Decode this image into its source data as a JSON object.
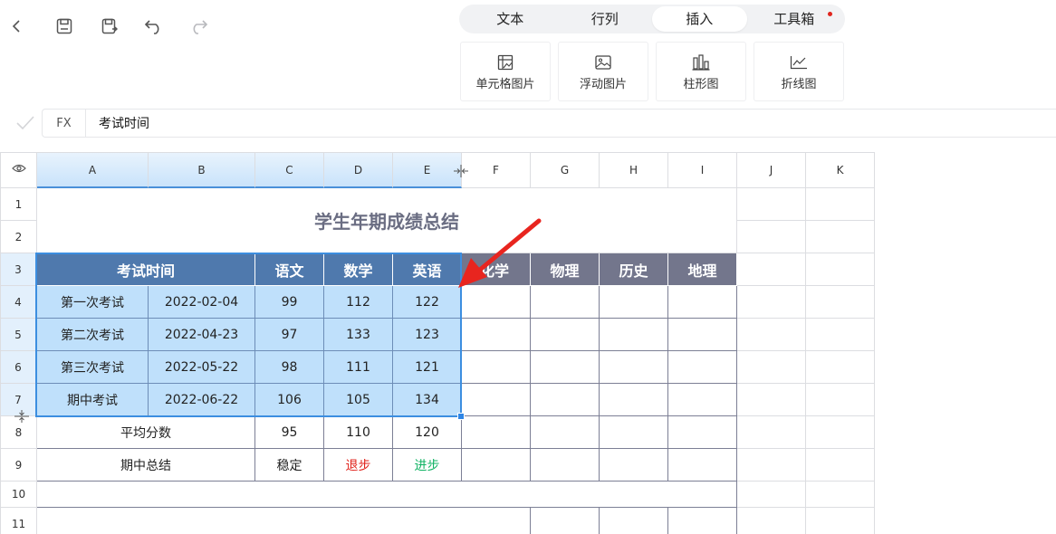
{
  "toolbar": {
    "tabs": [
      {
        "label": "文本",
        "active": false
      },
      {
        "label": "行列",
        "active": false
      },
      {
        "label": "插入",
        "active": true
      },
      {
        "label": "工具箱",
        "active": false,
        "notification": true
      }
    ],
    "insert_items": [
      {
        "label": "单元格图片",
        "icon": "cell-image-icon"
      },
      {
        "label": "浮动图片",
        "icon": "image-icon"
      },
      {
        "label": "柱形图",
        "icon": "bar-chart-icon"
      },
      {
        "label": "折线图",
        "icon": "line-chart-icon"
      }
    ]
  },
  "formula_bar": {
    "fx_label": "FX",
    "value": "考试时间"
  },
  "grid": {
    "columns": [
      "A",
      "B",
      "C",
      "D",
      "E",
      "F",
      "G",
      "H",
      "I",
      "J",
      "K"
    ],
    "rows": [
      "1",
      "2",
      "3",
      "4",
      "5",
      "6",
      "7",
      "8",
      "9",
      "10",
      "11"
    ],
    "title": "学生年期成绩总结",
    "header": {
      "exam_time": "考试时间",
      "chinese": "语文",
      "math": "数学",
      "english": "英语",
      "chemistry_partial": "化学",
      "physics": "物理",
      "history": "历史",
      "geography": "地理"
    },
    "data_rows": [
      {
        "exam": "第一次考试",
        "date": "2022-02-04",
        "chinese": "99",
        "math": "112",
        "english": "122"
      },
      {
        "exam": "第二次考试",
        "date": "2022-04-23",
        "chinese": "97",
        "math": "133",
        "english": "123"
      },
      {
        "exam": "第三次考试",
        "date": "2022-05-22",
        "chinese": "98",
        "math": "111",
        "english": "121"
      },
      {
        "exam": "期中考试",
        "date": "2022-06-22",
        "chinese": "106",
        "math": "105",
        "english": "134"
      }
    ],
    "average": {
      "label": "平均分数",
      "chinese": "95",
      "math": "110",
      "english": "120"
    },
    "summary": {
      "label": "期中总结",
      "chinese": "稳定",
      "math": "退步",
      "english": "进步"
    }
  },
  "colors": {
    "header_blue": "#4f79ad",
    "header_gray": "#73768c",
    "selection": "#bfe0fb",
    "decline": "#e0221b",
    "progress": "#11b364",
    "arrow": "#e8251f"
  }
}
